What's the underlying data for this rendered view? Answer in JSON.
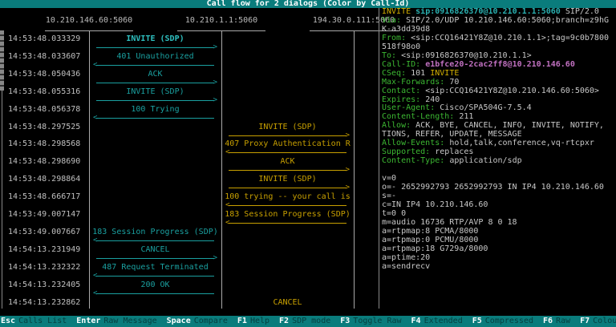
{
  "title": "Call flow for 2 dialogs (Color by Call-Id)",
  "lanes": [
    "10.210.146.60:5060",
    "10.210.1.1:5060",
    "194.30.0.111:5060"
  ],
  "colors": {
    "teal": "#1aa0a0",
    "yellow": "#c8a000"
  },
  "messages": [
    {
      "time": "14:53:48.033329",
      "label": "INVITE (SDP)",
      "from": 0,
      "to": 1,
      "color": "teal",
      "selected": true
    },
    {
      "time": "14:53:48.033607",
      "label": "401 Unauthorized",
      "from": 1,
      "to": 0,
      "color": "teal"
    },
    {
      "time": "14:53:48.050436",
      "label": "ACK",
      "from": 0,
      "to": 1,
      "color": "teal"
    },
    {
      "time": "14:53:48.055316",
      "label": "INVITE (SDP)",
      "from": 0,
      "to": 1,
      "color": "teal"
    },
    {
      "time": "14:53:48.056378",
      "label": "100 Trying",
      "from": 1,
      "to": 0,
      "color": "teal"
    },
    {
      "time": "14:53:48.297525",
      "label": "INVITE (SDP)",
      "from": 1,
      "to": 2,
      "color": "yellow"
    },
    {
      "time": "14:53:48.298568",
      "label": "407 Proxy Authentication R",
      "from": 2,
      "to": 1,
      "color": "yellow"
    },
    {
      "time": "14:53:48.298690",
      "label": "ACK",
      "from": 1,
      "to": 2,
      "color": "yellow"
    },
    {
      "time": "14:53:48.298864",
      "label": "INVITE (SDP)",
      "from": 1,
      "to": 2,
      "color": "yellow"
    },
    {
      "time": "14:53:48.666717",
      "label": "100 trying -- your call is",
      "from": 2,
      "to": 1,
      "color": "yellow"
    },
    {
      "time": "14:53:49.007147",
      "label": "183 Session Progress (SDP)",
      "from": 2,
      "to": 1,
      "color": "yellow"
    },
    {
      "time": "14:53:49.007667",
      "label": "183 Session Progress (SDP)",
      "from": 1,
      "to": 0,
      "color": "teal"
    },
    {
      "time": "14:54:13.231949",
      "label": "CANCEL",
      "from": 0,
      "to": 1,
      "color": "teal"
    },
    {
      "time": "14:54:13.232322",
      "label": "487 Request Terminated",
      "from": 1,
      "to": 0,
      "color": "teal"
    },
    {
      "time": "14:54:13.232405",
      "label": "200 OK",
      "from": 1,
      "to": 0,
      "color": "teal"
    },
    {
      "time": "14:54:13.232862",
      "label": "CANCEL",
      "from": 1,
      "to": 2,
      "color": "yellow",
      "cut": true
    }
  ],
  "raw": {
    "request_method": "INVITE",
    "request_uri": "sip:0916826370@10.210.1.1:5060",
    "request_version": "SIP/2.0",
    "headers": [
      {
        "name": "Via:",
        "value": "SIP/2.0/UDP 10.210.146.60:5060;branch=z9hG\nK-a3dd39d8"
      },
      {
        "name": "From:",
        "value": "<sip:CCQ16421Y8Z@10.210.1.1>;tag=9c0b7800\n518f98o0"
      },
      {
        "name": "To:",
        "value": "<sip:0916826370@10.210.1.1>"
      },
      {
        "name": "Call-ID:",
        "value": "e1bfce20-2cac2ff8@10.210.146.60",
        "style": "m"
      },
      {
        "name": "CSeq:",
        "value": "101 ",
        "extra": "INVITE"
      },
      {
        "name": "Max-Forwards:",
        "value": "70"
      },
      {
        "name": "Contact:",
        "value": "<sip:CCQ16421Y8Z@10.210.146.60:5060>"
      },
      {
        "name": "Expires:",
        "value": "240"
      },
      {
        "name": "User-Agent:",
        "value": "Cisco/SPA504G-7.5.4"
      },
      {
        "name": "Content-Length:",
        "value": "211"
      },
      {
        "name": "Allow:",
        "value": "ACK, BYE, CANCEL, INFO, INVITE, NOTIFY,\nTIONS, REFER, UPDATE, MESSAGE"
      },
      {
        "name": "Allow-Events:",
        "value": "hold,talk,conference,vq-rtcpxr"
      },
      {
        "name": "Supported:",
        "value": "replaces"
      },
      {
        "name": "Content-Type:",
        "value": "application/sdp"
      }
    ],
    "sdp": [
      "v=0",
      "o=- 2652992793 2652992793 IN IP4 10.210.146.60",
      "s=-",
      "c=IN IP4 10.210.146.60",
      "t=0 0",
      "m=audio 16736 RTP/AVP 8 0 18",
      "a=rtpmap:8 PCMA/8000",
      "a=rtpmap:0 PCMU/8000",
      "a=rtpmap:18 G729a/8000",
      "a=ptime:20",
      "a=sendrecv"
    ]
  },
  "footer": [
    {
      "key": "Esc",
      "label": "Calls List"
    },
    {
      "key": "Enter",
      "label": "Raw Message"
    },
    {
      "key": "Space",
      "label": "Compare"
    },
    {
      "key": "F1",
      "label": "Help"
    },
    {
      "key": "F2",
      "label": "SDP mode"
    },
    {
      "key": "F3",
      "label": "Toggle Raw"
    },
    {
      "key": "F4",
      "label": "Extended"
    },
    {
      "key": "F5",
      "label": "Compressed"
    },
    {
      "key": "F6",
      "label": "Raw"
    },
    {
      "key": "F7",
      "label": "Colour"
    }
  ]
}
